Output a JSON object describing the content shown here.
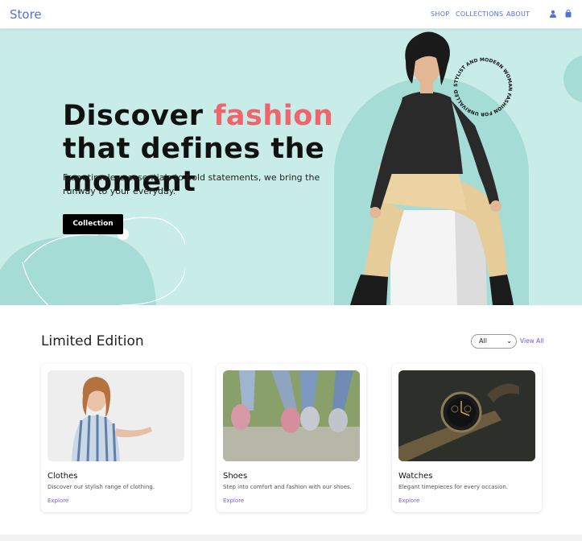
{
  "nav": {
    "brand": "Store",
    "items": [
      "SHOP",
      "COLLECTIONS",
      "ABOUT"
    ],
    "icons": [
      "user-icon",
      "bag-icon"
    ],
    "accent_color": "#4f73d9"
  },
  "hero": {
    "headline_part1": "Discover ",
    "headline_accent": "fashion",
    "headline_part2": " that defines the moment",
    "subtitle": "From timeless essentials to bold statements, we bring the runway to your everyday.",
    "cta_label": "Collection",
    "badge_text": "STYLIST AND MODERN WOMAN FASHION FOR UNRIVALLED WEAR ",
    "bg_color": "#c8ece8",
    "accent_color": "#f0646b"
  },
  "section": {
    "title": "Limited Edition",
    "filter_value": "All",
    "view_all": "View All"
  },
  "cards": [
    {
      "title": "Clothes",
      "desc": "Discover our stylish range of clothing.",
      "link": "Explore"
    },
    {
      "title": "Shoes",
      "desc": "Step into comfort and fashion with our shoes.",
      "link": "Explore"
    },
    {
      "title": "Watches",
      "desc": "Elegant timepieces for every occasion.",
      "link": "Explore"
    }
  ]
}
